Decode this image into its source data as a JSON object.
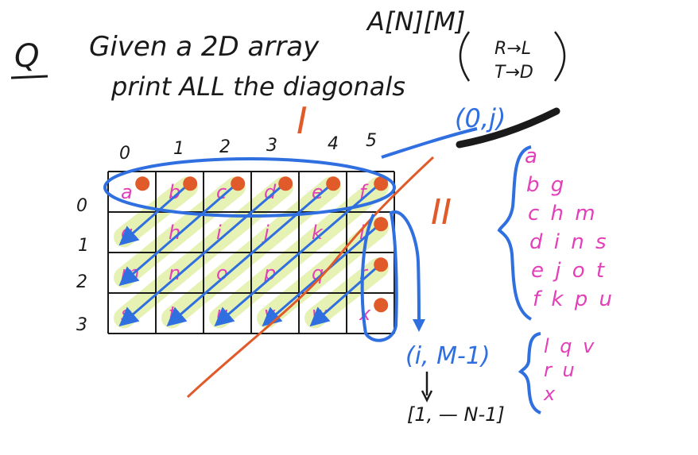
{
  "question": {
    "marker": "Q",
    "line1": "Given a 2D array",
    "array_ref": "A[N][M]",
    "line2": "print ALL the diagonals",
    "dir1": "R→L",
    "dir2": "T→D"
  },
  "grid": {
    "col_headers": [
      "0",
      "1",
      "2",
      "3",
      "4",
      "5"
    ],
    "row_headers": [
      "0",
      "1",
      "2",
      "3"
    ],
    "cells": [
      [
        "a",
        "b",
        "c",
        "d",
        "e",
        "f"
      ],
      [
        "g",
        "h",
        "i",
        "j",
        "k",
        "l"
      ],
      [
        "m",
        "n",
        "o",
        "p",
        "q",
        "r"
      ],
      [
        "s",
        "t",
        "u",
        "v",
        "w",
        "x"
      ]
    ]
  },
  "annotations": {
    "region1": "I",
    "region2": "II",
    "start_top": "(0,j)",
    "start_right": "(i, M-1)",
    "start_right_range": "[1, — N-1]"
  },
  "diagonals": {
    "part1": [
      "a",
      "b g",
      "c h m",
      "d i n s",
      "e j o t",
      "f k p u"
    ],
    "part2": [
      "l q v",
      "r u",
      "x"
    ]
  },
  "colors": {
    "ink": "#1a1a1a",
    "blue": "#2f6fe0",
    "pink": "#e23fb8",
    "orange": "#e05a2a",
    "highlight": "#e2f0a8"
  }
}
